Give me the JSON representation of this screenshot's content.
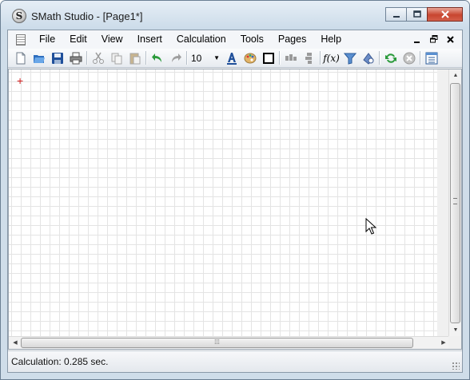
{
  "window": {
    "title": "SMath Studio - [Page1*]",
    "app_icon_letter": "S",
    "caption_buttons": [
      "minimize",
      "maximize",
      "close"
    ]
  },
  "menu": {
    "items": [
      "File",
      "Edit",
      "View",
      "Insert",
      "Calculation",
      "Tools",
      "Pages",
      "Help"
    ],
    "mdi_controls": [
      "minimize",
      "restore",
      "close"
    ]
  },
  "toolbar": {
    "buttons": [
      {
        "name": "new-icon"
      },
      {
        "name": "open-icon"
      },
      {
        "name": "save-icon"
      },
      {
        "name": "print-icon"
      },
      {
        "name": "cut-icon"
      },
      {
        "name": "copy-icon"
      },
      {
        "name": "paste-icon"
      },
      {
        "name": "undo-icon"
      },
      {
        "name": "redo-icon"
      },
      {
        "name": "font-color-icon"
      },
      {
        "name": "palette-icon"
      },
      {
        "name": "border-icon"
      },
      {
        "name": "align-horizontal-icon"
      },
      {
        "name": "align-vertical-icon"
      },
      {
        "name": "function-icon"
      },
      {
        "name": "filter-icon"
      },
      {
        "name": "dynamic-assistance-icon"
      },
      {
        "name": "recalculate-icon"
      },
      {
        "name": "stop-icon"
      },
      {
        "name": "sidebar-panel-icon"
      }
    ],
    "font_size": "10",
    "function_label": "f(x)"
  },
  "status": {
    "text": "Calculation: 0.285 sec."
  },
  "colors": {
    "titlebar": "#cbdbe9",
    "close_button": "#c8452f",
    "grid_line": "#e4e4e4",
    "cursor_marker": "#d42020"
  }
}
